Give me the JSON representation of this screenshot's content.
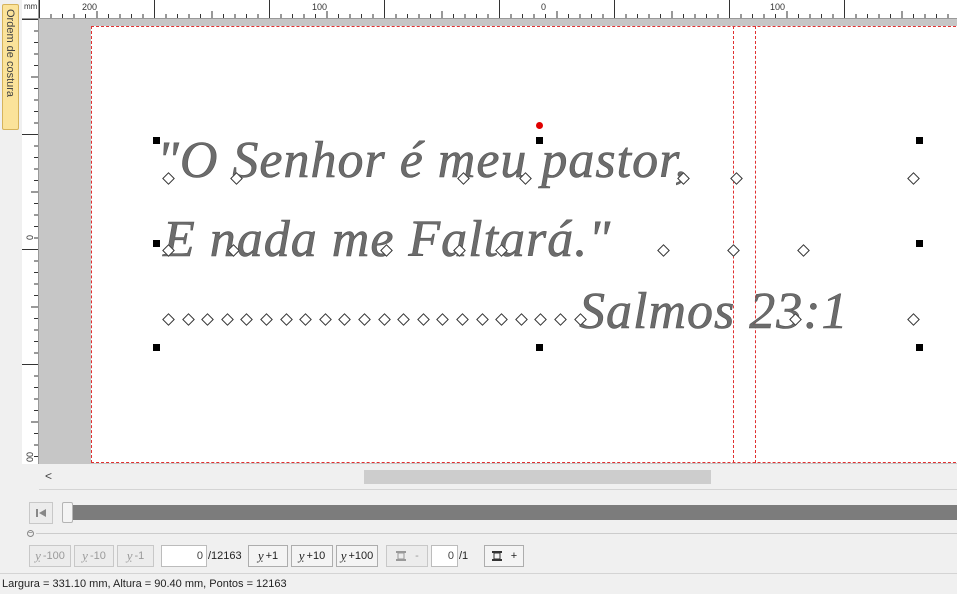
{
  "side_tab": {
    "label": "Ordem de costura"
  },
  "ruler": {
    "unit": "mm",
    "top_labels": [
      "200",
      "100",
      "0",
      "100"
    ],
    "left_labels": [
      "0",
      "00"
    ]
  },
  "design": {
    "line1": "\"O Senhor é meu pastor,",
    "line2": "E nada me Faltará.\"",
    "line3": "Salmos 23:1"
  },
  "timeline": {
    "stitch_value": "0",
    "stitch_total": "/12163",
    "layer_value": "0",
    "layer_total": "/1"
  },
  "toolbar": {
    "minus100": "-100",
    "minus10": "-10",
    "minus1": "-1",
    "plus1": "+1",
    "plus10": "+10",
    "plus100": "+100",
    "layer_minus": "-",
    "layer_plus": "+"
  },
  "status": {
    "text": "Largura = 331.10 mm, Altura = 90.40 mm, Pontos = 12163"
  },
  "colors": {
    "page_border": "#e03030",
    "stitch": "#6a6a6a",
    "side_tab": "#fbe39a",
    "rotation_handle": "#e00000"
  }
}
